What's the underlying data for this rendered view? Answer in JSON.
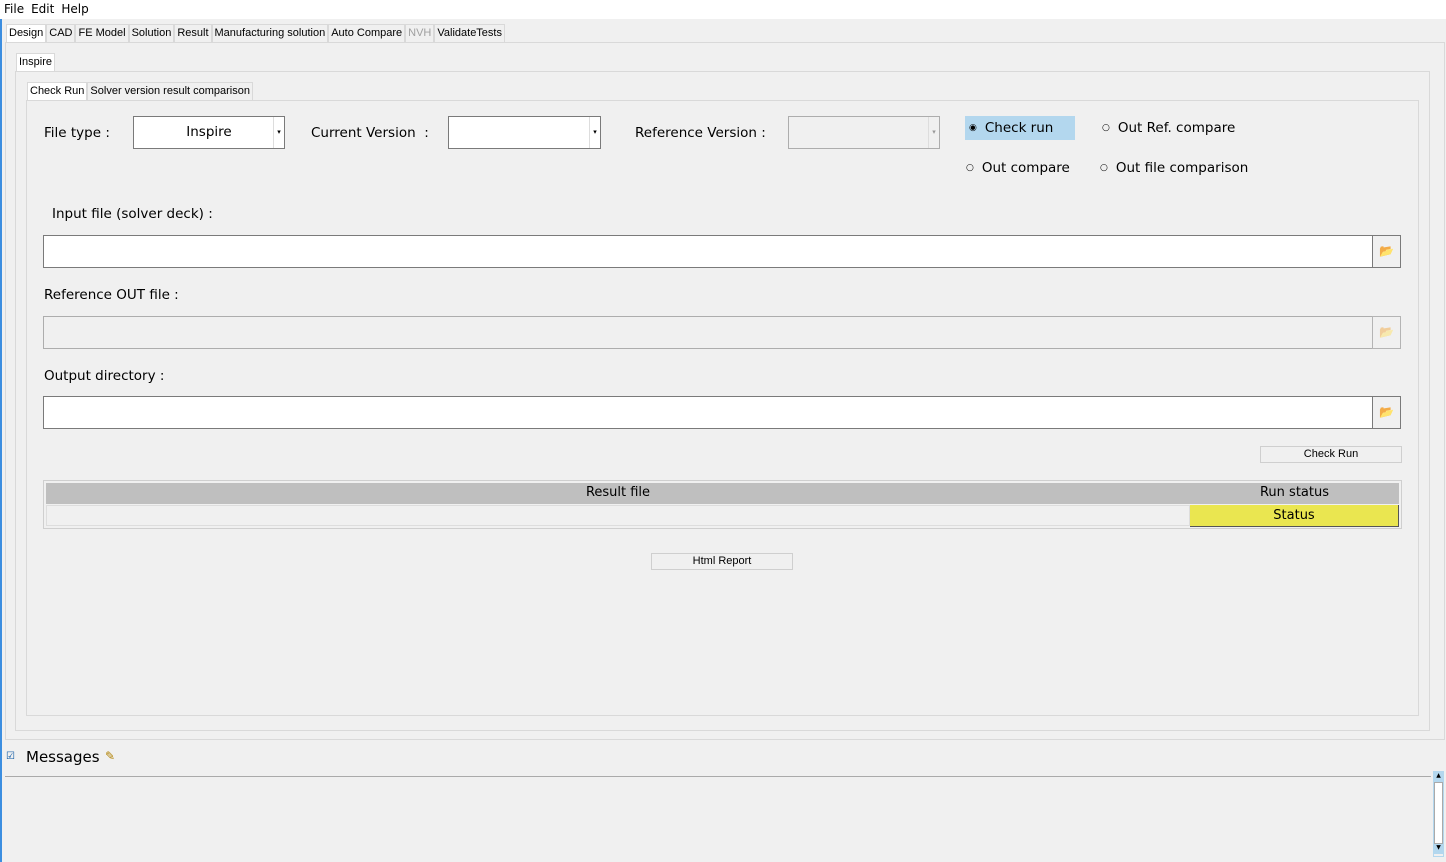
{
  "menu": [
    "File",
    "Edit",
    "Help"
  ],
  "main_tabs": [
    {
      "label": "Design",
      "active": true
    },
    {
      "label": "CAD"
    },
    {
      "label": "FE Model"
    },
    {
      "label": "Solution"
    },
    {
      "label": "Result"
    },
    {
      "label": "Manufacturing solution"
    },
    {
      "label": "Auto Compare"
    },
    {
      "label": "NVH",
      "disabled": true
    },
    {
      "label": "ValidateTests"
    }
  ],
  "sub_tab": "Inspire",
  "inner_tabs": [
    {
      "label": "Check Run",
      "active": true
    },
    {
      "label": "Solver version result comparison"
    }
  ],
  "form": {
    "file_type_label": "File type :",
    "file_type_value": "Inspire",
    "current_version_label": "Current Version  :",
    "current_version_value": "",
    "reference_version_label": "Reference Version :",
    "reference_version_value": "",
    "radios": [
      {
        "label": "Check run",
        "selected": true
      },
      {
        "label": "Out Ref. compare"
      },
      {
        "label": "Out compare"
      },
      {
        "label": "Out file comparison"
      }
    ],
    "input_file_label": "Input file (solver deck) :",
    "input_file_value": "",
    "ref_out_label": "Reference OUT file :",
    "ref_out_value": "",
    "output_dir_label": "Output directory :",
    "output_dir_value": "",
    "check_run_button": "Check Run",
    "html_report_button": "Html Report"
  },
  "table": {
    "headers": [
      "Result file",
      "Run status"
    ],
    "rows": [
      [
        "",
        "Status"
      ]
    ],
    "status_color": "#eae650"
  },
  "messages": {
    "label": "Messages",
    "checked": true
  }
}
